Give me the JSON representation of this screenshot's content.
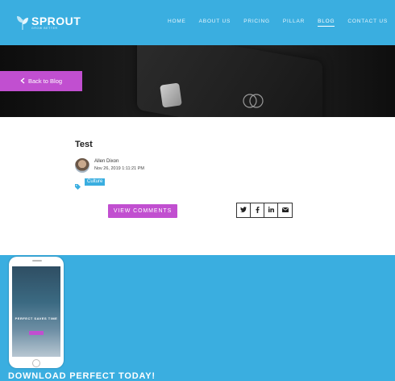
{
  "brand": {
    "name": "SPROUT",
    "tagline": "GROW BETTER"
  },
  "nav": {
    "items": [
      {
        "label": "HOME"
      },
      {
        "label": "ABOUT US"
      },
      {
        "label": "PRICING"
      },
      {
        "label": "PILLAR"
      },
      {
        "label": "BLOG",
        "active": true
      },
      {
        "label": "CONTACT US"
      }
    ]
  },
  "hero": {
    "back_label": "Back to Blog"
  },
  "post": {
    "title": "Test",
    "author": "Allen Dixon",
    "date": "Nov 26, 2019 1:11:21 PM",
    "tag": "Culture",
    "view_comments_label": "VIEW COMMENTS",
    "share_icons": [
      "twitter-icon",
      "facebook-icon",
      "linkedin-icon",
      "email-icon"
    ]
  },
  "promo": {
    "title": "DOWNLOAD PERFECT TODAY!",
    "phone_headline": "PERFECT SAVES TIME"
  },
  "colors": {
    "brand_blue": "#3aaee0",
    "accent_purple": "#c14fd0"
  }
}
